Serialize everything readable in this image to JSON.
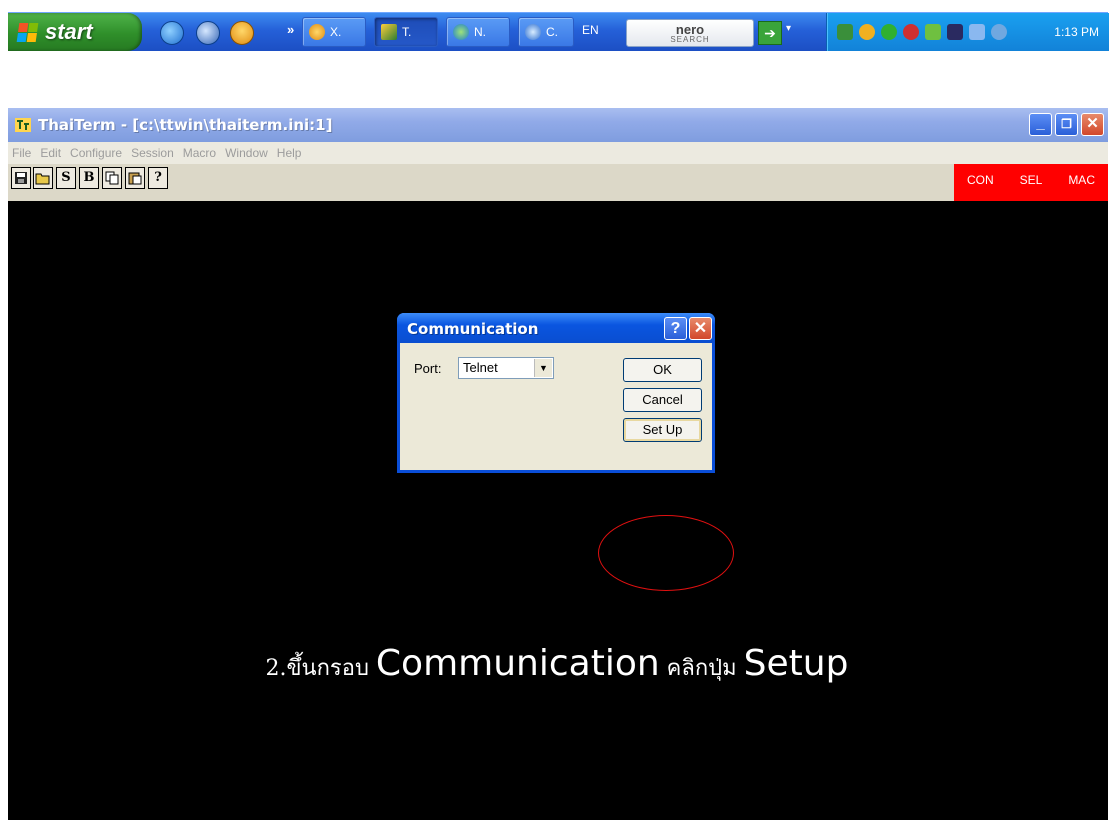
{
  "taskbar": {
    "start_label": "start",
    "chevron": "»",
    "tasks": [
      {
        "label": "X.",
        "icon": "paw-icon",
        "active": false
      },
      {
        "label": "T.",
        "icon": "thaiterm-icon",
        "active": true
      },
      {
        "label": "N.",
        "icon": "globe-icon",
        "active": false
      },
      {
        "label": "C.",
        "icon": "ie-icon",
        "active": false
      }
    ],
    "language": "EN",
    "nero_line1": "nero",
    "nero_line2": "SEARCH",
    "clock": "1:13 PM"
  },
  "window": {
    "title": "ThaiTerm - [c:\\ttwin\\thaiterm.ini:1]",
    "menu": [
      "File",
      "Edit",
      "Configure",
      "Session",
      "Macro",
      "Window",
      "Help"
    ],
    "toolbar_letters": {
      "s": "S",
      "b": "B",
      "help": "?"
    },
    "status": {
      "con": "CON",
      "sel": "SEL",
      "mac": "MAC"
    },
    "caption_buttons": {
      "minimize": "_",
      "maximize": "❐",
      "close": "✕"
    }
  },
  "dialog": {
    "title": "Communication",
    "help_glyph": "?",
    "close_glyph": "✕",
    "port_label": "Port:",
    "port_value": "Telnet",
    "ok": "OK",
    "cancel": "Cancel",
    "setup": "Set Up"
  },
  "caption": {
    "part1": "2.ขึ้นกรอบ ",
    "part2": "Communication",
    "part3": " คลิกปุ่ม ",
    "part4": "Setup"
  },
  "colors": {
    "terminal_bg": "#000000",
    "status_strip": "#ff0000",
    "highlight_ring": "#e01010"
  }
}
